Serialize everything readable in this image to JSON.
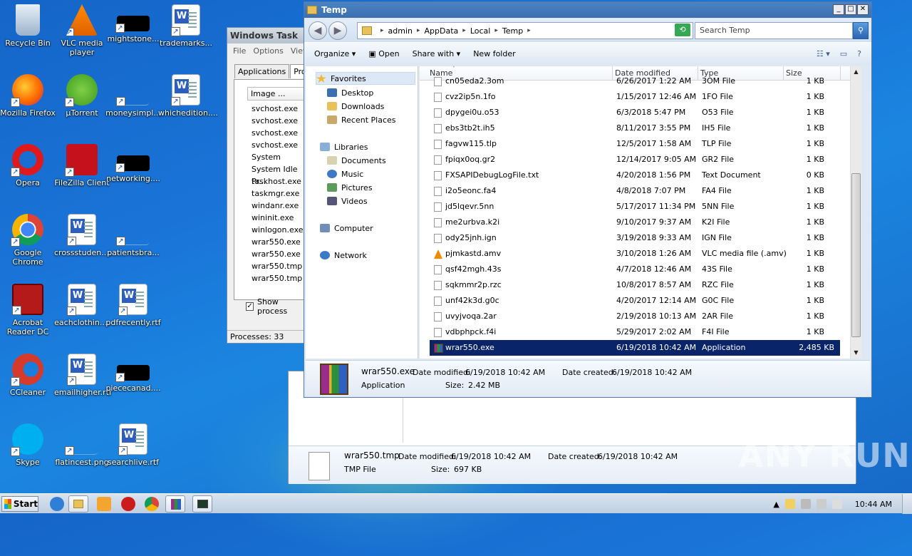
{
  "desktop": {
    "icons": [
      {
        "label": "Recycle Bin",
        "icon": "recycle-bin-icon"
      },
      {
        "label": "VLC media player",
        "icon": "vlc-icon"
      },
      {
        "label": "mightstone...",
        "icon": "black-thumbnail-icon"
      },
      {
        "label": "trademarks...",
        "icon": "word-doc-icon"
      },
      {
        "label": "Mozilla Firefox",
        "icon": "firefox-icon"
      },
      {
        "label": "µTorrent",
        "icon": "utorrent-icon"
      },
      {
        "label": "moneysimpl...",
        "icon": "blank-file-icon"
      },
      {
        "label": "whichedition....",
        "icon": "word-doc-icon"
      },
      {
        "label": "Opera",
        "icon": "opera-icon"
      },
      {
        "label": "FileZilla Client",
        "icon": "filezilla-icon"
      },
      {
        "label": "networking....",
        "icon": "black-thumbnail-icon"
      },
      {
        "label": "Google Chrome",
        "icon": "chrome-icon"
      },
      {
        "label": "crossstuden....",
        "icon": "word-doc-icon"
      },
      {
        "label": "patientsbra...",
        "icon": "blank-file-icon"
      },
      {
        "label": "Acrobat Reader DC",
        "icon": "acrobat-icon"
      },
      {
        "label": "eachclothin....",
        "icon": "word-doc-icon"
      },
      {
        "label": "pdfrecently.rtf",
        "icon": "word-doc-icon"
      },
      {
        "label": "CCleaner",
        "icon": "ccleaner-icon"
      },
      {
        "label": "emailhigher.rtf",
        "icon": "word-doc-icon"
      },
      {
        "label": "piececanad....",
        "icon": "black-thumbnail-icon"
      },
      {
        "label": "Skype",
        "icon": "skype-icon"
      },
      {
        "label": "flatincest.png",
        "icon": "blank-file-icon"
      },
      {
        "label": "searchlive.rtf",
        "icon": "word-doc-icon"
      }
    ]
  },
  "taskmgr": {
    "title": "Windows Task",
    "menu": [
      "File",
      "Options",
      "View"
    ],
    "tabs": [
      "Applications",
      "Proc"
    ],
    "column": "Image ...",
    "processes": [
      "svchost.exe",
      "svchost.exe",
      "svchost.exe",
      "svchost.exe",
      "System",
      "System Idle Pr...",
      "taskhost.exe",
      "taskmgr.exe",
      "windanr.exe",
      "wininit.exe",
      "winlogon.exe",
      "wrar550.exe",
      "wrar550.exe",
      "wrar550.tmp",
      "wrar550.tmp"
    ],
    "show_label": "Show process",
    "status": "Processes: 33"
  },
  "explorer": {
    "title": "Temp",
    "breadcrumb": [
      "admin",
      "AppData",
      "Local",
      "Temp"
    ],
    "search_placeholder": "Search Temp",
    "commands": {
      "organize": "Organize",
      "open": "Open",
      "share": "Share with",
      "new_folder": "New folder"
    },
    "nav": {
      "favorites": "Favorites",
      "desktop": "Desktop",
      "downloads": "Downloads",
      "recent": "Recent Places",
      "libraries": "Libraries",
      "documents": "Documents",
      "music": "Music",
      "pictures": "Pictures",
      "videos": "Videos",
      "computer": "Computer",
      "network": "Network"
    },
    "columns": {
      "name": "Name",
      "date": "Date modified",
      "type": "Type",
      "size": "Size"
    },
    "files": [
      {
        "name": "cn05eda2.3om",
        "date": "6/26/2017 1:22 AM",
        "type": "3OM File",
        "size": "1 KB"
      },
      {
        "name": "cvz2ip5n.1fo",
        "date": "1/15/2017 12:46 AM",
        "type": "1FO File",
        "size": "1 KB"
      },
      {
        "name": "dpygei0u.o53",
        "date": "6/3/2018 5:47 PM",
        "type": "O53 File",
        "size": "1 KB"
      },
      {
        "name": "ebs3tb2t.ih5",
        "date": "8/11/2017 3:55 PM",
        "type": "IH5 File",
        "size": "1 KB"
      },
      {
        "name": "fagvw115.tlp",
        "date": "12/5/2017 1:58 AM",
        "type": "TLP File",
        "size": "1 KB"
      },
      {
        "name": "fpiqx0oq.gr2",
        "date": "12/14/2017 9:05 AM",
        "type": "GR2 File",
        "size": "1 KB"
      },
      {
        "name": "FXSAPIDebugLogFile.txt",
        "date": "4/20/2018 1:56 PM",
        "type": "Text Document",
        "size": "0 KB"
      },
      {
        "name": "i2o5eonc.fa4",
        "date": "4/8/2018 7:07 PM",
        "type": "FA4 File",
        "size": "1 KB"
      },
      {
        "name": "jd5lqevr.5nn",
        "date": "5/17/2017 11:34 PM",
        "type": "5NN File",
        "size": "1 KB"
      },
      {
        "name": "me2urbva.k2i",
        "date": "9/10/2017 9:37 AM",
        "type": "K2I File",
        "size": "1 KB"
      },
      {
        "name": "ody25jnh.ign",
        "date": "3/19/2018 9:33 AM",
        "type": "IGN File",
        "size": "1 KB"
      },
      {
        "name": "pjmkastd.amv",
        "date": "3/10/2018 1:26 AM",
        "type": "VLC media file (.amv)",
        "size": "1 KB"
      },
      {
        "name": "qsf42mgh.43s",
        "date": "4/7/2018 12:46 AM",
        "type": "43S File",
        "size": "1 KB"
      },
      {
        "name": "sqkmmr2p.rzc",
        "date": "10/8/2017 8:57 AM",
        "type": "RZC File",
        "size": "1 KB"
      },
      {
        "name": "unf42k3d.g0c",
        "date": "4/20/2017 12:14 AM",
        "type": "G0C File",
        "size": "1 KB"
      },
      {
        "name": "uvyjvoqa.2ar",
        "date": "2/19/2018 10:13 AM",
        "type": "2AR File",
        "size": "1 KB"
      },
      {
        "name": "vdbphpck.f4i",
        "date": "5/29/2017 2:02 AM",
        "type": "F4I File",
        "size": "1 KB"
      },
      {
        "name": "wrar550.exe",
        "date": "6/19/2018 10:42 AM",
        "type": "Application",
        "size": "2,485 KB"
      }
    ],
    "details": {
      "name": "wrar550.exe",
      "modified_label": "Date modified:",
      "modified": "6/19/2018 10:42 AM",
      "created_label": "Date created:",
      "created": "6/19/2018 10:42 AM",
      "type": "Application",
      "size_label": "Size:",
      "size": "2.42 MB"
    }
  },
  "bg_explorer": {
    "details": {
      "name": "wrar550.tmp",
      "modified_label": "Date modified:",
      "modified": "6/19/2018 10:42 AM",
      "created_label": "Date created:",
      "created": "6/19/2018 10:42 AM",
      "type": "TMP File",
      "size_label": "Size:",
      "size": "697 KB"
    }
  },
  "taskbar": {
    "start": "Start",
    "clock": "10:44 AM"
  },
  "watermark": "ANY RUN",
  "colors": {
    "selection": "#0a246a",
    "titlebar_active": "#3b6fb0",
    "desktop": "#1a75d8"
  }
}
